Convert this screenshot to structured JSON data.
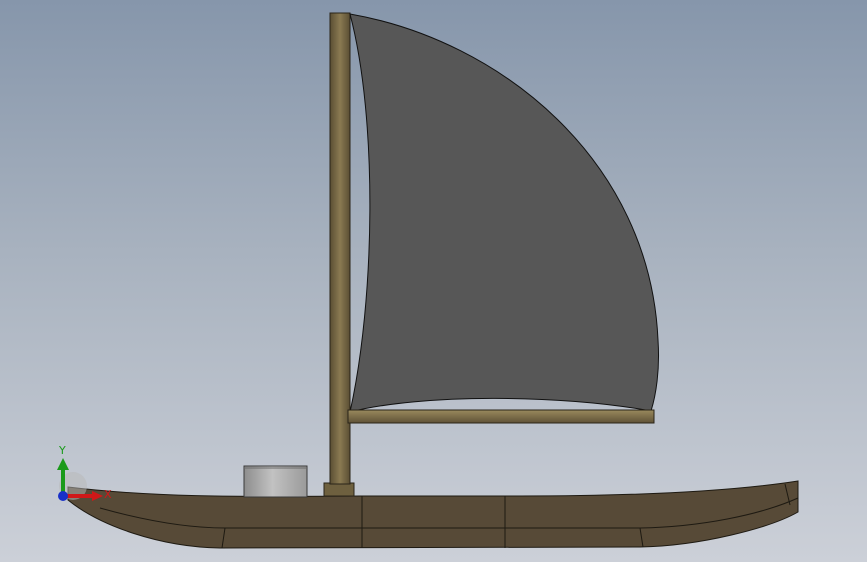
{
  "viewport": {
    "background_top": "#8696ab",
    "background_bottom": "#ccd0d8"
  },
  "model": {
    "parts": [
      "hull",
      "mast",
      "mast-step",
      "boom",
      "sail",
      "cabin-cylinder"
    ],
    "colors": {
      "hull": "#574a37",
      "mast": "#6e603f",
      "boom": "#7a6a46",
      "sail": "#575757",
      "cabin": "#a9a9a9"
    }
  },
  "triad": {
    "x_label": "X",
    "y_label": "Y",
    "x_color": "#d01818",
    "y_color": "#1a9a1a",
    "z_color": "#1830c8"
  }
}
